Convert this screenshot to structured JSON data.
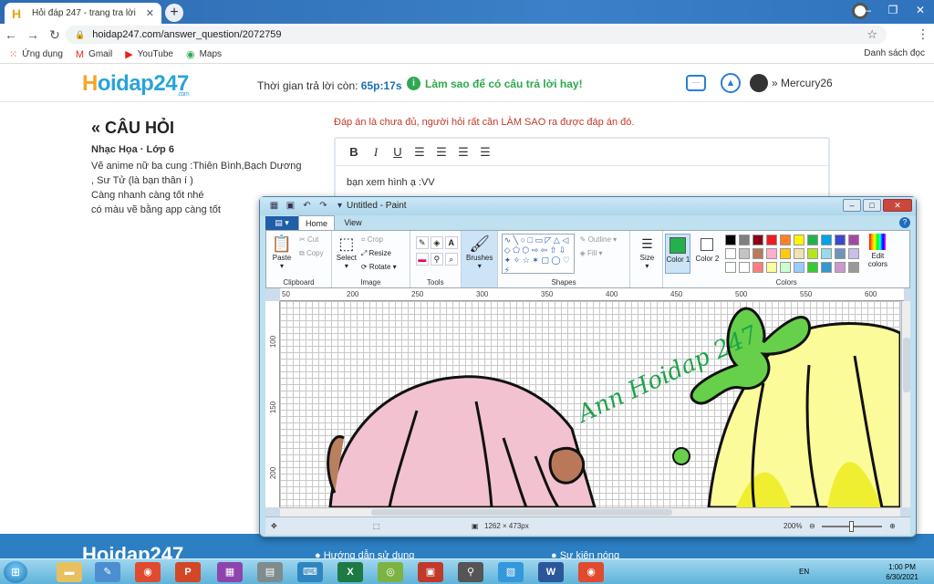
{
  "browser": {
    "tab_title": "Hỏi đáp 247 - trang tra lời",
    "tab_favicon": "H",
    "url": "hoidap247.com/answer_question/2072759",
    "bookmarks": [
      {
        "label": "Ứng dụng",
        "icon": "apps-grid-icon",
        "glyph": "⁙",
        "color": "#d93025"
      },
      {
        "label": "Gmail",
        "icon": "gmail-icon",
        "glyph": "M",
        "color": "#d93025"
      },
      {
        "label": "YouTube",
        "icon": "youtube-icon",
        "glyph": "▶",
        "color": "#e62117"
      },
      {
        "label": "Maps",
        "icon": "maps-icon",
        "glyph": "◉",
        "color": "#34a853"
      }
    ],
    "reading_list": "Danh sách đọc"
  },
  "site": {
    "logo_h": "H",
    "logo_rest": "oidap247",
    "logo_sub": ".com",
    "timer_label": "Thời gian trả lời còn: ",
    "timer_value": "65p:17s",
    "howto": "Làm sao để có câu trả lời hay!",
    "username": "Mercury26",
    "question_title": "CÂU HỎI",
    "question_meta": "Nhạc Họa · Lớp 6",
    "question_lines": [
      "Vẽ anime nữ ba cung :Thiên Bình,Bạch Dương",
      ", Sư Tử (là bạn thân í )",
      "Càng nhanh càng tốt nhé",
      "có màu vẽ bằng app càng tốt"
    ],
    "note": "Đáp án là chưa đủ, người hỏi rất cần LÀM SAO ra được đáp án đó.",
    "editor_text": "bạn xem hình ạ :VV",
    "footer_logo": "Hoidap247",
    "footer_links": [
      "Hướng dẫn sử dụng",
      "Sự kiện nóng"
    ]
  },
  "paint": {
    "title": "Untitled - Paint",
    "tabs": [
      "Home",
      "View"
    ],
    "clipboard": {
      "paste": "Paste",
      "cut": "Cut",
      "copy": "Copy",
      "label": "Clipboard"
    },
    "image": {
      "select": "Select",
      "crop": "Crop",
      "resize": "Resize",
      "rotate": "Rotate",
      "label": "Image"
    },
    "tools_label": "Tools",
    "brushes": "Brushes",
    "shapes": {
      "outline": "Outline",
      "fill": "Fill",
      "label": "Shapes"
    },
    "size": "Size",
    "color1": "Color 1",
    "color2": "Color 2",
    "edit_colors": "Edit colors",
    "colors_label": "Colors",
    "color1_value": "#22b14c",
    "palette": [
      "#000000",
      "#7f7f7f",
      "#880015",
      "#ed1c24",
      "#ff7f27",
      "#fff200",
      "#22b14c",
      "#00a2e8",
      "#3f48cc",
      "#a349a4",
      "#ffffff",
      "#c3c3c3",
      "#b97a57",
      "#ffaec9",
      "#ffc90e",
      "#efe4b0",
      "#b5e61d",
      "#99d9ea",
      "#7092be",
      "#c8bfe7",
      "#ffffff",
      "#ffffff",
      "#ff7f7f",
      "#ffff99",
      "#ccffcc",
      "#99ccff",
      "#33cc33",
      "#3399cc",
      "#cc99cc",
      "#999999"
    ],
    "ruler_h": [
      "50",
      "200",
      "250",
      "300",
      "350",
      "400",
      "450",
      "500",
      "550",
      "600"
    ],
    "ruler_v": [
      "100",
      "150",
      "200"
    ],
    "signature_text": "Ann Hoidap 247",
    "status_dimensions": "1262 × 473px",
    "zoom": "200%"
  },
  "taskbar": {
    "lang": "EN",
    "time": "1:00 PM",
    "date": "6/30/2021"
  }
}
